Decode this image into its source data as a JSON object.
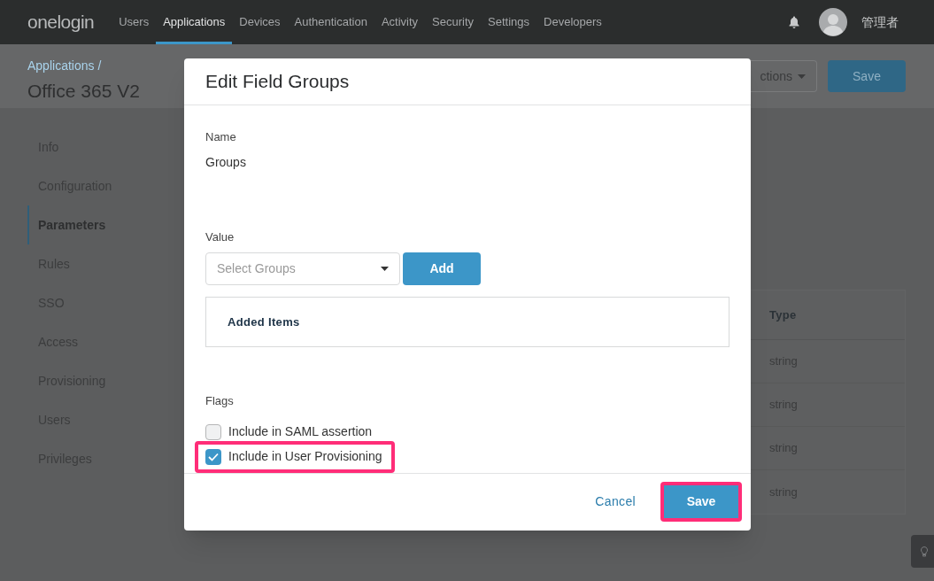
{
  "nav": {
    "logo": "onelogin",
    "items": [
      {
        "label": "Users",
        "selected": false
      },
      {
        "label": "Applications",
        "selected": true
      },
      {
        "label": "Devices",
        "selected": false
      },
      {
        "label": "Authentication",
        "selected": false
      },
      {
        "label": "Activity",
        "selected": false
      },
      {
        "label": "Security",
        "selected": false
      },
      {
        "label": "Settings",
        "selected": false
      },
      {
        "label": "Developers",
        "selected": false
      }
    ],
    "user": "管理者"
  },
  "header": {
    "breadcrumb": "Applications /",
    "title": "Office 365 V2",
    "actions_button": "ctions",
    "save_button": "Save"
  },
  "sidebar": {
    "items": [
      {
        "label": "Info",
        "selected": false
      },
      {
        "label": "Configuration",
        "selected": false
      },
      {
        "label": "Parameters",
        "selected": true
      },
      {
        "label": "Rules",
        "selected": false
      },
      {
        "label": "SSO",
        "selected": false
      },
      {
        "label": "Access",
        "selected": false
      },
      {
        "label": "Provisioning",
        "selected": false
      },
      {
        "label": "Users",
        "selected": false
      },
      {
        "label": "Privileges",
        "selected": false
      }
    ]
  },
  "table": {
    "columns": [
      "Type"
    ],
    "rows": [
      [
        "string"
      ],
      [
        "string"
      ],
      [
        "string"
      ],
      [
        "string"
      ]
    ]
  },
  "dialog": {
    "title": "Edit Field Groups",
    "name_label": "Name",
    "name_value": "Groups",
    "value_label": "Value",
    "select_placeholder": "Select Groups",
    "add_button": "Add",
    "added_items_title": "Added Items",
    "flags_label": "Flags",
    "flags": [
      {
        "label": "Include in SAML assertion",
        "checked": false,
        "highlighted": false
      },
      {
        "label": "Include in User Provisioning",
        "checked": true,
        "highlighted": true
      }
    ],
    "cancel_button": "Cancel",
    "save_button": {
      "label": "Save",
      "highlighted": true
    }
  }
}
